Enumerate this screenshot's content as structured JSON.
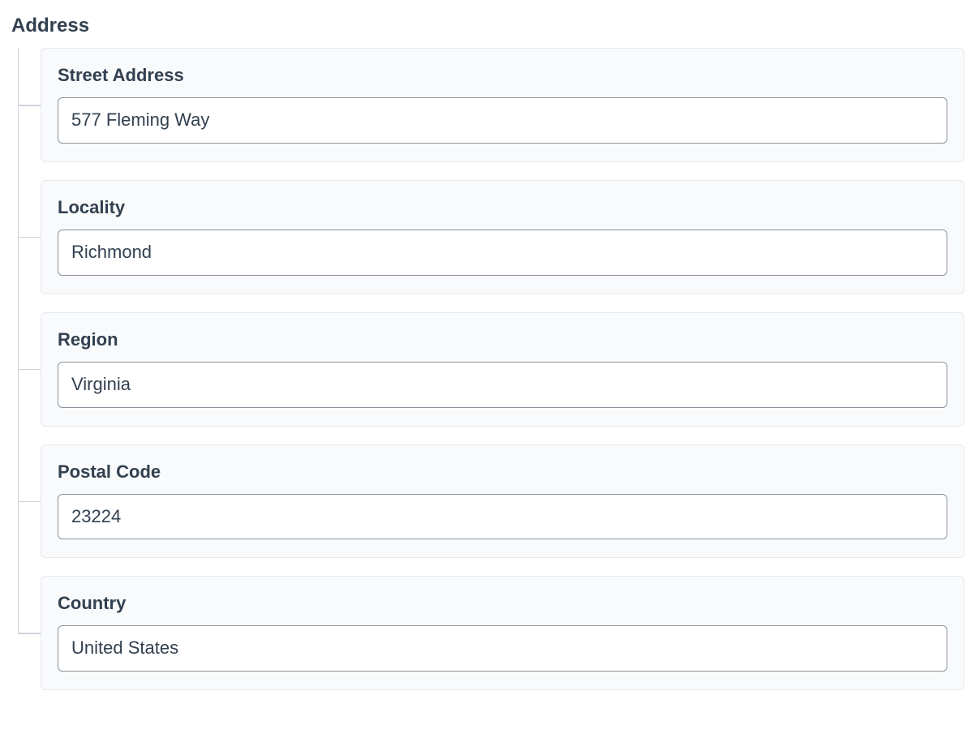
{
  "section": {
    "title": "Address"
  },
  "fields": {
    "streetAddress": {
      "label": "Street Address",
      "value": "577 Fleming Way"
    },
    "locality": {
      "label": "Locality",
      "value": "Richmond"
    },
    "region": {
      "label": "Region",
      "value": "Virginia"
    },
    "postalCode": {
      "label": "Postal Code",
      "value": "23224"
    },
    "country": {
      "label": "Country",
      "value": "United States"
    }
  }
}
